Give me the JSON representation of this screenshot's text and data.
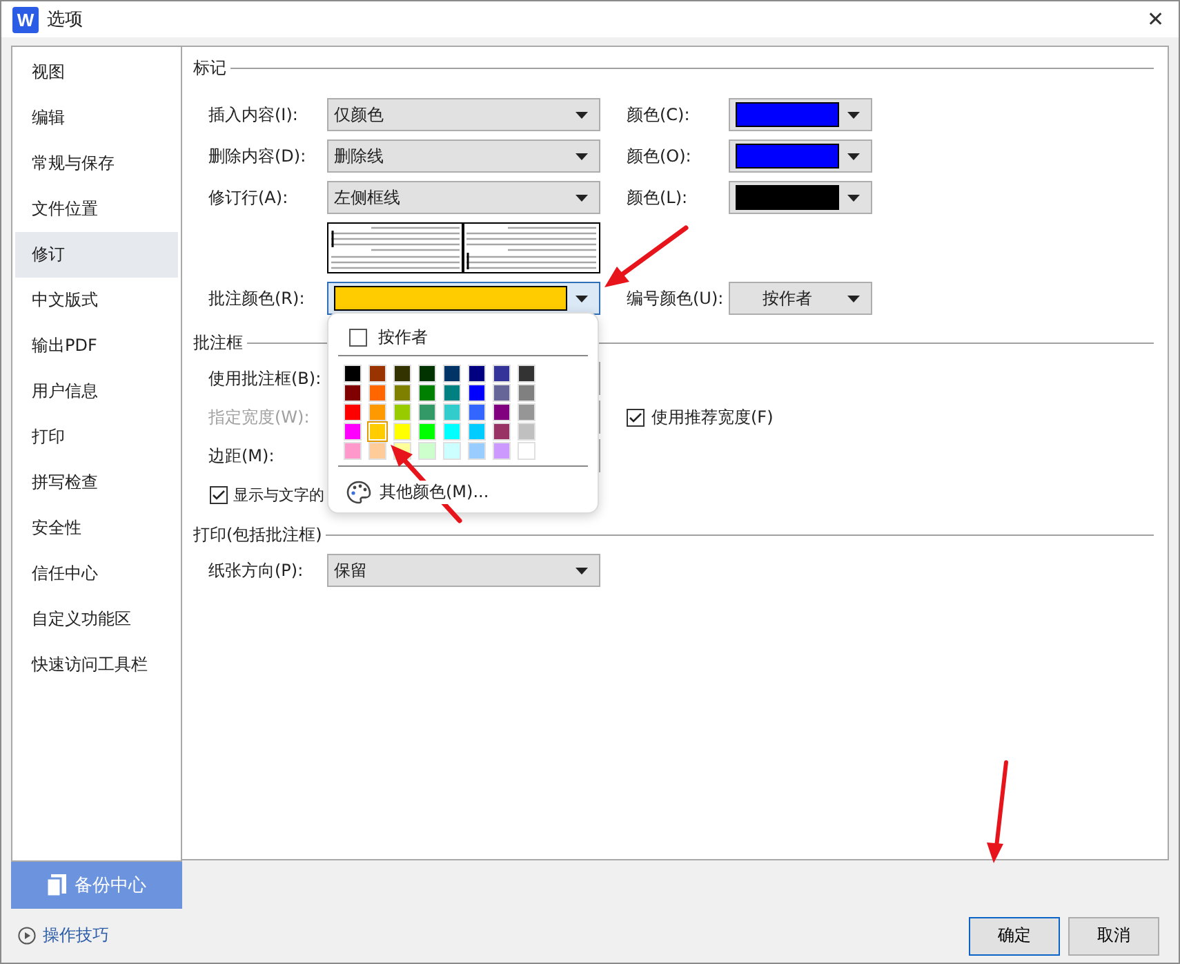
{
  "window": {
    "logo": "W",
    "title": "选项",
    "close": "✕"
  },
  "sidebar": {
    "items": [
      {
        "label": "视图",
        "selected": false
      },
      {
        "label": "编辑",
        "selected": false
      },
      {
        "label": "常规与保存",
        "selected": false
      },
      {
        "label": "文件位置",
        "selected": false
      },
      {
        "label": "修订",
        "selected": true
      },
      {
        "label": "中文版式",
        "selected": false
      },
      {
        "label": "输出PDF",
        "selected": false
      },
      {
        "label": "用户信息",
        "selected": false
      },
      {
        "label": "打印",
        "selected": false
      },
      {
        "label": "拼写检查",
        "selected": false
      },
      {
        "label": "安全性",
        "selected": false
      },
      {
        "label": "信任中心",
        "selected": false
      },
      {
        "label": "自定义功能区",
        "selected": false
      },
      {
        "label": "快速访问工具栏",
        "selected": false
      }
    ],
    "backup_button": "备份中心",
    "tips_link": "操作技巧"
  },
  "markup": {
    "title": "标记",
    "rows": [
      {
        "label": "插入内容(I):",
        "value": "仅颜色",
        "color_label": "颜色(C):",
        "color": "#0000ff"
      },
      {
        "label": "删除内容(D):",
        "value": "删除线",
        "color_label": "颜色(O):",
        "color": "#0000ff"
      },
      {
        "label": "修订行(A):",
        "value": "左侧框线",
        "color_label": "颜色(L):",
        "color": "#000000"
      }
    ],
    "comment_color": {
      "label": "批注颜色(R):",
      "color": "#ffcc00"
    },
    "number_color": {
      "label": "编号颜色(U):",
      "value": "按作者"
    }
  },
  "balloons": {
    "title": "批注框",
    "use_label": "使用批注框(B):",
    "width_label": "指定宽度(W):",
    "width_disabled": true,
    "recommended": {
      "label": "使用推荐宽度(F)",
      "checked": true
    },
    "margin_label": "边距(M):",
    "show_lines": {
      "label": "显示与文字的",
      "checked": true
    }
  },
  "print": {
    "title": "打印(包括批注框)",
    "orientation_label": "纸张方向(P):",
    "orientation_value": "保留"
  },
  "color_popup": {
    "by_author": {
      "label": "按作者",
      "checked": false
    },
    "swatches": [
      [
        {
          "color": "#000000",
          "selected": false
        },
        {
          "color": "#993300",
          "selected": false
        },
        {
          "color": "#333300",
          "selected": false
        },
        {
          "color": "#003300",
          "selected": false
        },
        {
          "color": "#003366",
          "selected": false
        },
        {
          "color": "#000080",
          "selected": false
        },
        {
          "color": "#333399",
          "selected": false
        },
        {
          "color": "#333333",
          "selected": false
        }
      ],
      [
        {
          "color": "#800000",
          "selected": false
        },
        {
          "color": "#ff6600",
          "selected": false
        },
        {
          "color": "#808000",
          "selected": false
        },
        {
          "color": "#008000",
          "selected": false
        },
        {
          "color": "#008080",
          "selected": false
        },
        {
          "color": "#0000ff",
          "selected": false
        },
        {
          "color": "#666699",
          "selected": false
        },
        {
          "color": "#808080",
          "selected": false
        }
      ],
      [
        {
          "color": "#ff0000",
          "selected": false
        },
        {
          "color": "#ff9900",
          "selected": false
        },
        {
          "color": "#99cc00",
          "selected": false
        },
        {
          "color": "#339966",
          "selected": false
        },
        {
          "color": "#33cccc",
          "selected": false
        },
        {
          "color": "#3366ff",
          "selected": false
        },
        {
          "color": "#800080",
          "selected": false
        },
        {
          "color": "#969696",
          "selected": false
        }
      ],
      [
        {
          "color": "#ff00ff",
          "selected": false
        },
        {
          "color": "#ffcc00",
          "selected": true
        },
        {
          "color": "#ffff00",
          "selected": false
        },
        {
          "color": "#00ff00",
          "selected": false
        },
        {
          "color": "#00ffff",
          "selected": false
        },
        {
          "color": "#00ccff",
          "selected": false
        },
        {
          "color": "#993366",
          "selected": false
        },
        {
          "color": "#c0c0c0",
          "selected": false
        }
      ],
      [
        {
          "color": "#ff99cc",
          "selected": false
        },
        {
          "color": "#ffcc99",
          "selected": false
        },
        {
          "color": "#ffff99",
          "selected": false
        },
        {
          "color": "#ccffcc",
          "selected": false
        },
        {
          "color": "#ccffff",
          "selected": false
        },
        {
          "color": "#99ccff",
          "selected": false
        },
        {
          "color": "#cc99ff",
          "selected": false
        },
        {
          "color": "#ffffff",
          "selected": false
        }
      ]
    ],
    "more_colors": "其他颜色(M)..."
  },
  "buttons": [
    {
      "label": "确定",
      "kind": "primary"
    },
    {
      "label": "取消",
      "kind": "normal"
    }
  ]
}
